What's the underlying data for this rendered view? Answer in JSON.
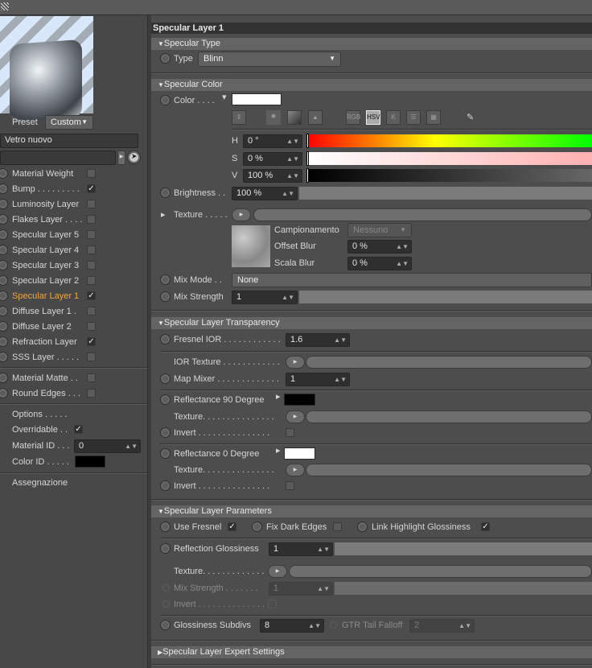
{
  "window": {
    "title": "Specular Layer 1"
  },
  "material": {
    "preset_label": "Preset",
    "preset_value": "Custom",
    "name": "Vetro nuovo",
    "link_value": ""
  },
  "layers": [
    {
      "label": "Material Weight",
      "checked": false
    },
    {
      "label": "Bump . . . . . . . . .",
      "checked": true
    },
    {
      "label": "Luminosity Layer",
      "checked": false
    },
    {
      "label": "Flakes Layer . . . .",
      "checked": false
    },
    {
      "label": "Specular Layer 5",
      "checked": false
    },
    {
      "label": "Specular Layer 4",
      "checked": false
    },
    {
      "label": "Specular Layer 3",
      "checked": false
    },
    {
      "label": "Specular Layer 2",
      "checked": false
    },
    {
      "label": "Specular Layer 1",
      "checked": true,
      "active": true
    },
    {
      "label": "Diffuse Layer 1 .",
      "checked": false
    },
    {
      "label": "Diffuse Layer 2",
      "checked": false
    },
    {
      "label": "Refraction Layer",
      "checked": true
    },
    {
      "label": "SSS Layer . . . . .",
      "checked": false
    },
    {
      "label": "Material Matte . .",
      "checked": false
    },
    {
      "label": "Round Edges . . .",
      "checked": false
    }
  ],
  "options": {
    "label": "Options . . . . .",
    "overridable_label": "Overridable . .",
    "overridable": true,
    "material_id_label": "Material ID . . .",
    "material_id": "0",
    "color_id_label": "Color ID . . . . .",
    "color_id": "#000000",
    "assign_label": "Assegnazione"
  },
  "specular_type": {
    "header": "Specular Type",
    "type_label": "Type",
    "type_value": "Blinn"
  },
  "specular_color": {
    "header": "Specular Color",
    "color_label": "Color . . . .",
    "color": "#ffffff",
    "modes": [
      "RGB",
      "HSV",
      "K"
    ],
    "active_mode": "HSV",
    "h_label": "H",
    "h": "0 °",
    "s_label": "S",
    "s": "0 %",
    "v_label": "V",
    "v": "100 %",
    "brightness_label": "Brightness . .",
    "brightness": "100 %",
    "texture_label": "Texture . . . . .",
    "sampling_label": "Campionamento",
    "sampling_value": "Nessuno",
    "offset_blur_label": "Offset Blur",
    "offset_blur": "0 %",
    "scale_blur_label": "Scala Blur",
    "scale_blur": "0 %",
    "mix_mode_label": "Mix Mode . .",
    "mix_mode": "None",
    "mix_strength_label": "Mix Strength",
    "mix_strength": "1"
  },
  "transparency": {
    "header": "Specular Layer Transparency",
    "fresnel_ior_label": "Fresnel IOR . . . . . . . . . . . .",
    "fresnel_ior": "1.6",
    "ior_texture_label": "IOR Texture . . . . . . . . . . . .",
    "map_mixer_label": "Map Mixer . . . . . . . . . . . . .",
    "map_mixer": "1",
    "refl90_label": "Reflectance 90 Degree",
    "refl90_color": "#000000",
    "texture_label": "Texture. . . . . . . . . . . . . . .",
    "invert_label": "Invert . . . . . . . . . . . . . . .",
    "refl0_label": "Reflectance  0 Degree",
    "refl0_color": "#ffffff"
  },
  "parameters": {
    "header": "Specular Layer Parameters",
    "use_fresnel_label": "Use Fresnel",
    "use_fresnel": true,
    "fix_dark_edges_label": "Fix Dark Edges",
    "fix_dark_edges": false,
    "link_gloss_label": "Link Highlight Glossiness",
    "link_gloss": true,
    "refl_gloss_label": "Reflection Glossiness",
    "refl_gloss": "1",
    "texture_label": "Texture. . . . . . . . . . . . .",
    "mix_strength_label": "Mix Strength . . . . . . .",
    "mix_strength": "1",
    "invert_label": "Invert . . . . . . . . . . . . . .",
    "gloss_subdivs_label": "Glossiness Subdivs",
    "gloss_subdivs": "8",
    "gtr_label": "GTR Tail Falloff",
    "gtr": "2"
  },
  "expert": {
    "header": "Specular Layer Expert Settings"
  }
}
